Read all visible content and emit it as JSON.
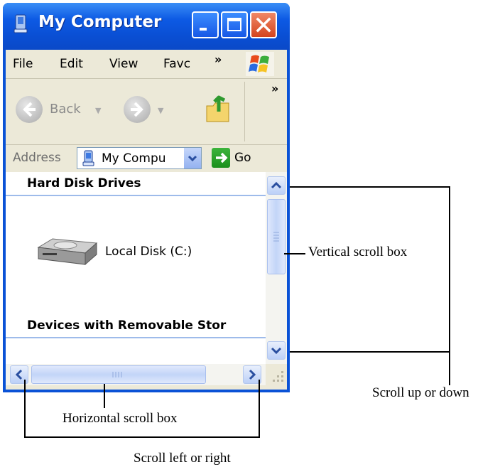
{
  "window": {
    "title": "My Computer",
    "buttons": {
      "minimize": "minimize",
      "maximize": "maximize",
      "close": "close"
    }
  },
  "menubar": {
    "items": [
      "File",
      "Edit",
      "View",
      "Favc"
    ],
    "overflow": "»"
  },
  "toolbar": {
    "back_label": "Back",
    "overflow": "»"
  },
  "address": {
    "label": "Address",
    "value": "My Compu",
    "go_label": "Go"
  },
  "content": {
    "groups": [
      {
        "heading": "Hard Disk Drives",
        "items": [
          {
            "label": "Local Disk (C:)",
            "icon": "hard-disk-icon"
          }
        ]
      },
      {
        "heading": "Devices with Removable Stor",
        "items": []
      }
    ]
  },
  "annotations": {
    "vertical_scroll_box": "Vertical scroll box",
    "scroll_up_down": "Scroll up or down",
    "horizontal_scroll_box": "Horizontal scroll box",
    "scroll_left_right": "Scroll left or right"
  },
  "colors": {
    "titlebar": "#0a52d6",
    "close_button": "#d4441e",
    "scrollbar_blue": "#c3d5f8",
    "window_face": "#ece9d8"
  }
}
